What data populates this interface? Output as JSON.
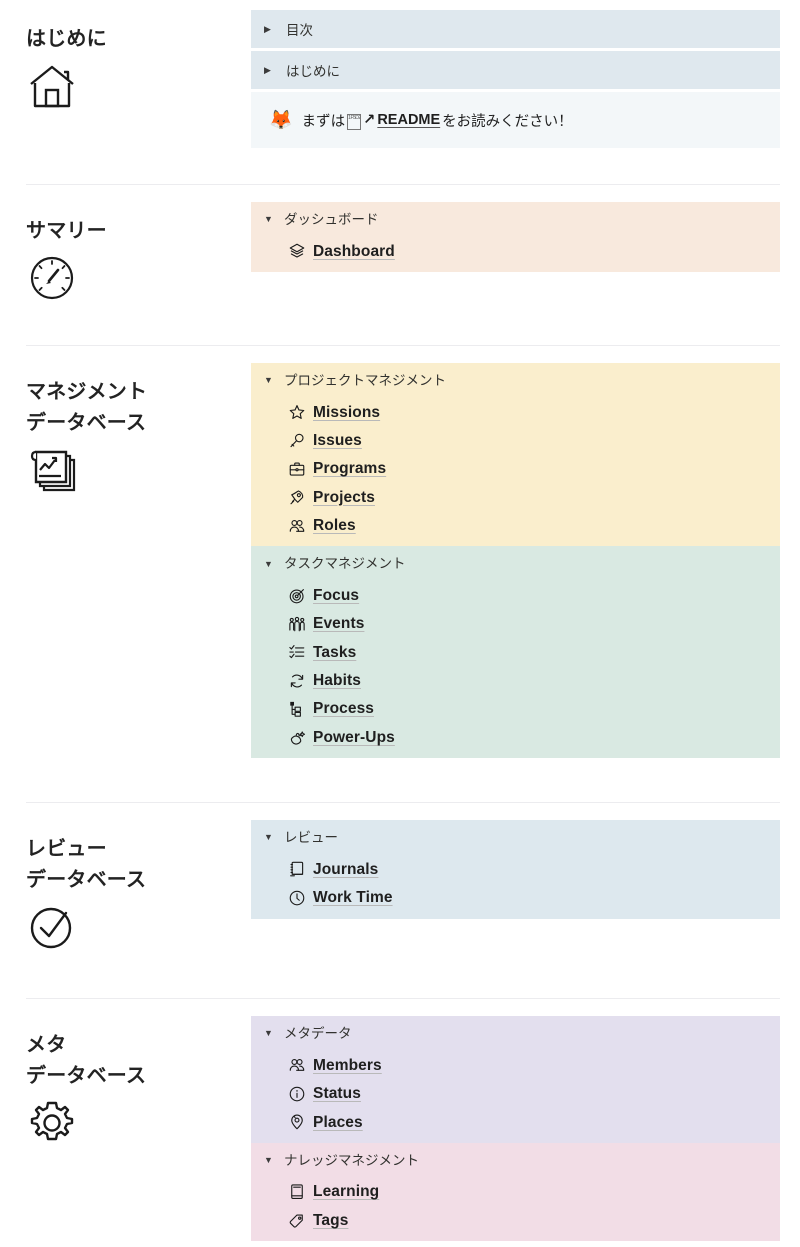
{
  "colors": {
    "intro_row_bg": "#dfe8ee",
    "intro_callout_bg": "#f3f7f9",
    "summary_bg": "#f8e9dd",
    "project_bg": "#faeecd",
    "task_bg": "#d9e9e2",
    "review_bg": "#dde8ee",
    "meta_bg": "#e3dfee",
    "knowledge_bg": "#f2dde6",
    "divider": "#ececef",
    "text": "#1f1f1f",
    "underline": "#b9b9b9"
  },
  "sections": [
    {
      "id": "intro",
      "title": "はじめに",
      "icon": "house-icon",
      "type": "intro",
      "toc_rows": [
        {
          "caret": "▶",
          "label": "目次"
        },
        {
          "caret": "▶",
          "label": "はじめに"
        }
      ],
      "callout": {
        "emoji": "🦊",
        "text_before": "まずは",
        "missing_glyph": "1F5D2",
        "arrow": "↗",
        "link_label": "README",
        "text_after": " をお読みください！"
      }
    },
    {
      "id": "summary",
      "title": "サマリー",
      "icon": "gauge-icon",
      "type": "groups",
      "groups": [
        {
          "id": "dashboard-group",
          "caret": "▼",
          "heading": "ダッシュボード",
          "bg": "#f8e9dd",
          "items": [
            {
              "icon": "layers-icon",
              "label": "Dashboard"
            }
          ]
        }
      ]
    },
    {
      "id": "management",
      "title": "マネジメント\nデータベース",
      "icon": "chart-documents-icon",
      "type": "groups",
      "groups": [
        {
          "id": "project-management-group",
          "caret": "▼",
          "heading": "プロジェクトマネジメント",
          "bg": "#faeecd",
          "items": [
            {
              "icon": "star-icon",
              "label": "Missions"
            },
            {
              "icon": "magnifier-icon",
              "label": "Issues"
            },
            {
              "icon": "briefcase-icon",
              "label": "Programs"
            },
            {
              "icon": "rocket-icon",
              "label": "Projects"
            },
            {
              "icon": "people-icon",
              "label": "Roles"
            }
          ]
        },
        {
          "id": "task-management-group",
          "caret": "▼",
          "heading": "タスクマネジメント",
          "bg": "#d9e9e2",
          "items": [
            {
              "icon": "target-icon",
              "label": "Focus"
            },
            {
              "icon": "crowd-icon",
              "label": "Events"
            },
            {
              "icon": "checklist-icon",
              "label": "Tasks"
            },
            {
              "icon": "repeat-icon",
              "label": "Habits"
            },
            {
              "icon": "hierarchy-icon",
              "label": "Process"
            },
            {
              "icon": "magic-icon",
              "label": "Power-Ups"
            }
          ]
        }
      ]
    },
    {
      "id": "review",
      "title": "レビュー\nデータベース",
      "icon": "check-circle-icon",
      "type": "groups",
      "groups": [
        {
          "id": "review-group",
          "caret": "▼",
          "heading": "レビュー",
          "bg": "#dde8ee",
          "items": [
            {
              "icon": "notebook-icon",
              "label": "Journals"
            },
            {
              "icon": "clock-icon",
              "label": "Work Time"
            }
          ]
        }
      ]
    },
    {
      "id": "meta",
      "title": "メタ\nデータベース",
      "icon": "gear-icon",
      "type": "groups",
      "groups": [
        {
          "id": "metadata-group",
          "caret": "▼",
          "heading": "メタデータ",
          "bg": "#e3dfee",
          "items": [
            {
              "icon": "people-icon",
              "label": "Members"
            },
            {
              "icon": "info-icon",
              "label": "Status"
            },
            {
              "icon": "map-pin-icon",
              "label": "Places"
            }
          ]
        },
        {
          "id": "knowledge-management-group",
          "caret": "▼",
          "heading": "ナレッジマネジメント",
          "bg": "#f2dde6",
          "items": [
            {
              "icon": "book-icon",
              "label": "Learning"
            },
            {
              "icon": "tag-icon",
              "label": "Tags"
            }
          ]
        }
      ]
    }
  ]
}
